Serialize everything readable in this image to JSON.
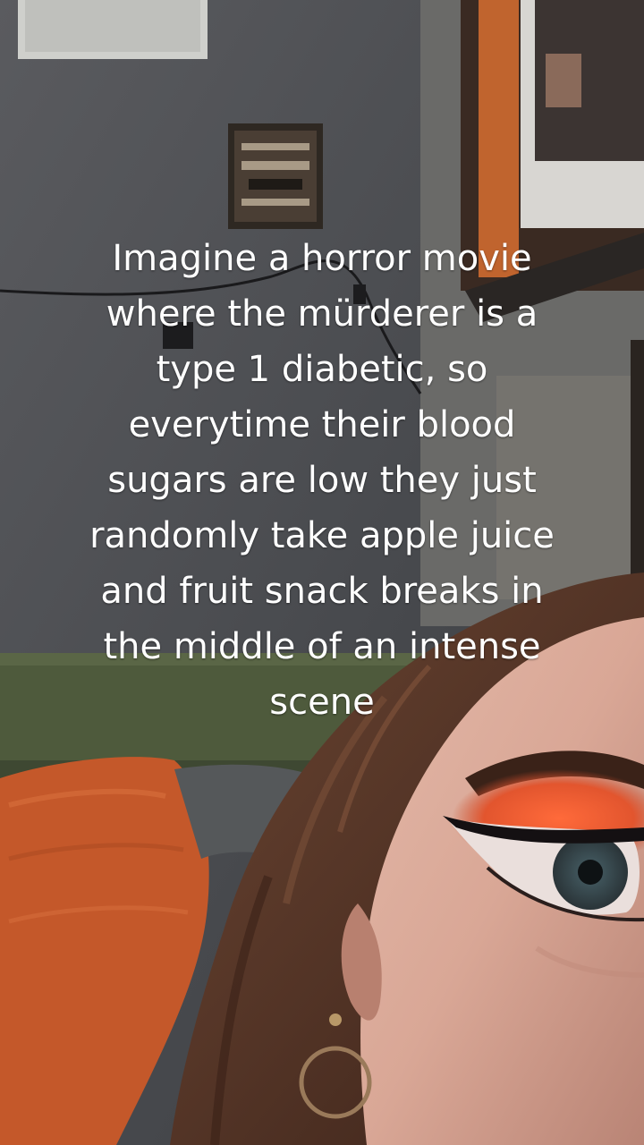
{
  "caption": {
    "lines": [
      "Imagine a horror movie",
      "where the mürderer is a",
      "type 1 diabetic, so",
      "everytime their blood",
      "sugars are low they just",
      "randomly take apple juice",
      "and fruit snack breaks in",
      "the middle of an intense",
      "scene"
    ]
  },
  "colors": {
    "wall": "#4a4c50",
    "couch": "#4e5a3c",
    "pillow": "#c4582a",
    "hair": "#5a3a2a",
    "skin": "#d8a898",
    "eyeshadow": "#e2552e",
    "caption_text": "#ffffff"
  }
}
